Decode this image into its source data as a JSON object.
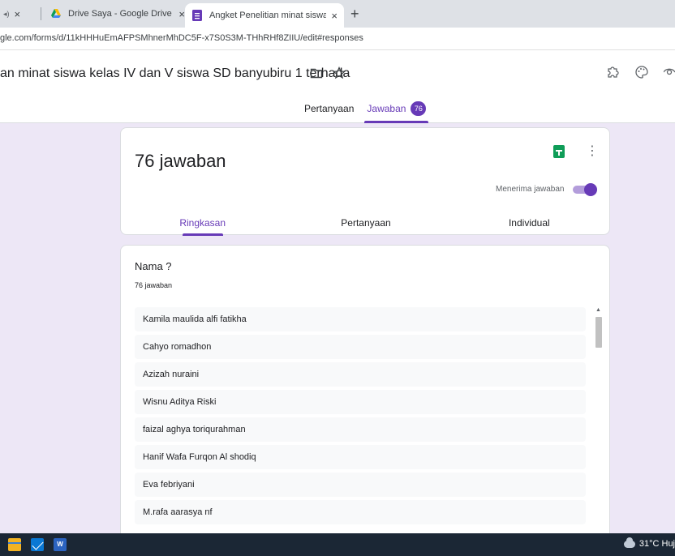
{
  "browser": {
    "partial_tab_close": "×",
    "tabs": [
      {
        "title": "Drive Saya - Google Drive",
        "close": "×"
      },
      {
        "title": "Angket Penelitian minat siswa kel",
        "close": "×"
      }
    ],
    "new_tab": "+",
    "url": "gle.com/forms/d/11kHHHuEmAFPSMhnerMhDC5F-x7S0S3M-THhRHf8ZIIU/edit#responses"
  },
  "form": {
    "title": "an minat siswa kelas IV dan V siswa SD banyubiru 1 terhada",
    "nav_tabs": [
      {
        "label": "Pertanyaan",
        "active": false
      },
      {
        "label": "Jawaban",
        "active": true,
        "badge": "76"
      }
    ]
  },
  "summary": {
    "response_count": "76 jawaban",
    "accepting_label": "Menerima jawaban",
    "accepting": true,
    "sub_tabs": [
      {
        "label": "Ringkasan",
        "active": true
      },
      {
        "label": "Pertanyaan",
        "active": false
      },
      {
        "label": "Individual",
        "active": false
      }
    ]
  },
  "question": {
    "title": "Nama ?",
    "count": "76 jawaban",
    "responses": [
      "Kamila maulida alfi fatikha",
      "Cahyo romadhon",
      "Azizah nuraini",
      "Wisnu Aditya Riski",
      "faizal aghya toriqurahman",
      "Hanif Wafa Furqon Al shodiq",
      "Eva febriyani",
      "M.rafa aarasya nf"
    ]
  },
  "taskbar": {
    "weather": "31°C Huj"
  },
  "colors": {
    "accent": "#673ab7",
    "background": "#ede7f6",
    "sheets": "#0f9d58"
  }
}
